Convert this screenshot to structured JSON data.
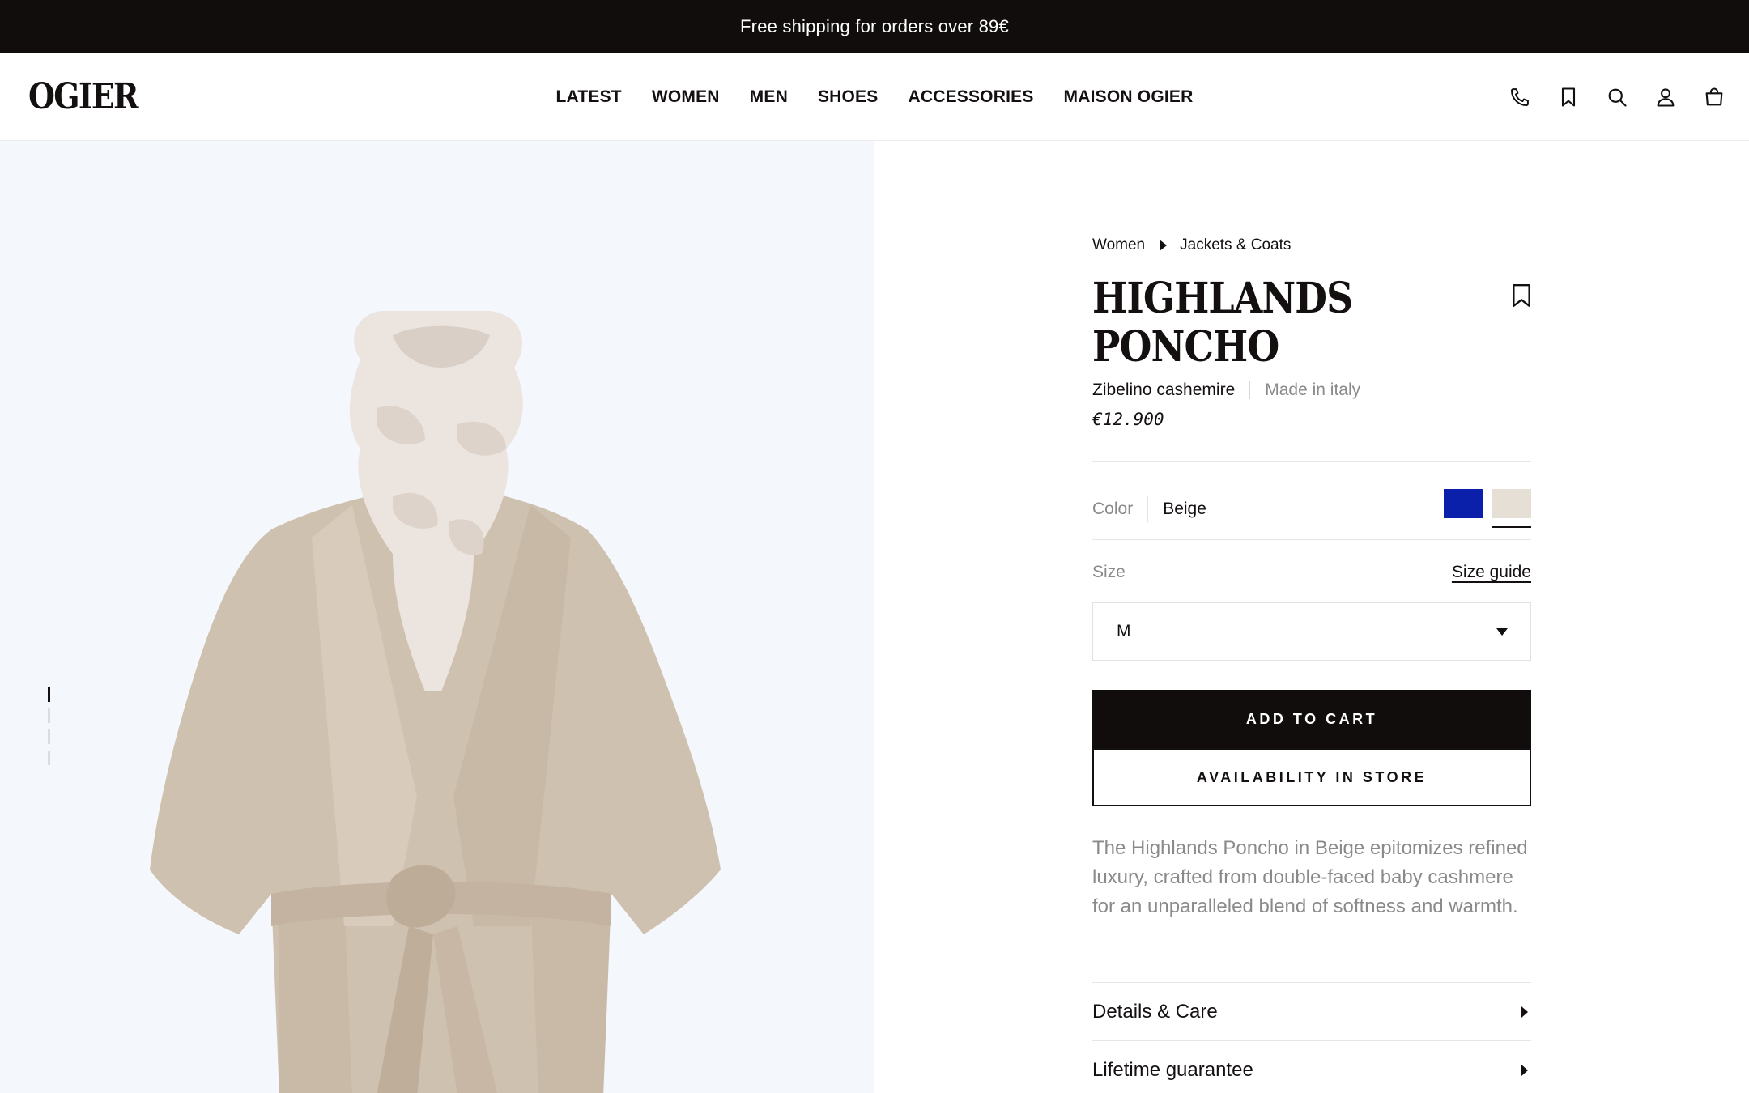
{
  "announcement": "Free shipping for orders over 89€",
  "header": {
    "logo": "OGIER",
    "nav": [
      "LATEST",
      "WOMEN",
      "MEN",
      "SHOES",
      "ACCESSORIES",
      "MAISON OGIER"
    ],
    "icons": [
      "phone-icon",
      "bookmark-icon",
      "search-icon",
      "account-icon",
      "bag-icon"
    ]
  },
  "gallery": {
    "image_count": 4,
    "active_index": 1
  },
  "product": {
    "breadcrumb": [
      "Women",
      "Jackets & Coats"
    ],
    "title": "HIGHLANDS PONCHO",
    "material": "Zibelino cashemire",
    "origin": "Made in italy",
    "price": "€12.900",
    "color_label": "Color",
    "color_value": "Beige",
    "swatches": [
      {
        "name": "Blue",
        "hex": "#0a1faa",
        "selected": false
      },
      {
        "name": "Beige",
        "hex": "#e6dfd6",
        "selected": true
      }
    ],
    "size_label": "Size",
    "size_guide": "Size guide",
    "size_selected": "M",
    "add_to_cart": "ADD TO CART",
    "availability": "AVAILABILITY IN STORE",
    "description": "The Highlands Poncho in Beige epitomizes refined luxury, crafted from double-faced baby cashmere for an unparalleled blend of softness and warmth.",
    "accordions": [
      "Details & Care",
      "Lifetime guarantee"
    ]
  },
  "colors": {
    "dark": "#120d0d",
    "gallery_bg": "#f4f7fb",
    "muted_text": "#8a8a8a"
  }
}
